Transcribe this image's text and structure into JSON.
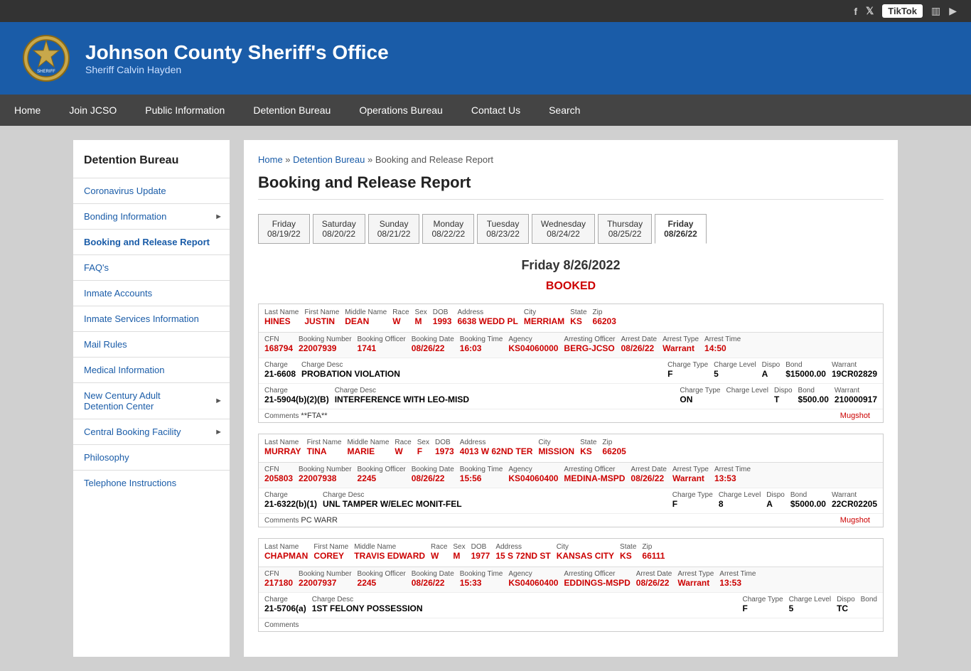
{
  "topBar": {
    "socialLinks": [
      {
        "label": "Facebook",
        "icon": "f",
        "symbol": "f"
      },
      {
        "label": "Twitter",
        "icon": "t",
        "symbol": "𝕏"
      },
      {
        "label": "TikTok",
        "icon": "tiktok",
        "symbol": "TikTok"
      },
      {
        "label": "Instagram",
        "icon": "camera",
        "symbol": "📷"
      },
      {
        "label": "YouTube",
        "icon": "play",
        "symbol": "▶"
      }
    ]
  },
  "header": {
    "title": "Johnson County Sheriff's Office",
    "subtitle": "Sheriff Calvin Hayden"
  },
  "nav": {
    "items": [
      {
        "label": "Home",
        "href": "#"
      },
      {
        "label": "Join JCSO",
        "href": "#"
      },
      {
        "label": "Public Information",
        "href": "#"
      },
      {
        "label": "Detention Bureau",
        "href": "#"
      },
      {
        "label": "Operations Bureau",
        "href": "#"
      },
      {
        "label": "Contact Us",
        "href": "#"
      },
      {
        "label": "Search",
        "href": "#"
      }
    ]
  },
  "sidebar": {
    "title": "Detention Bureau",
    "items": [
      {
        "label": "Coronavirus Update",
        "hasArrow": false
      },
      {
        "label": "Bonding Information",
        "hasArrow": true
      },
      {
        "label": "Booking and Release Report",
        "hasArrow": false,
        "active": true
      },
      {
        "label": "FAQ's",
        "hasArrow": false
      },
      {
        "label": "Inmate Accounts",
        "hasArrow": false
      },
      {
        "label": "Inmate Services Information",
        "hasArrow": false
      },
      {
        "label": "Mail Rules",
        "hasArrow": false
      },
      {
        "label": "Medical Information",
        "hasArrow": false
      },
      {
        "label": "New Century Adult Detention Center",
        "hasArrow": true
      },
      {
        "label": "Central Booking Facility",
        "hasArrow": true
      },
      {
        "label": "Philosophy",
        "hasArrow": false
      },
      {
        "label": "Telephone Instructions",
        "hasArrow": false
      }
    ]
  },
  "breadcrumb": {
    "links": [
      "Home",
      "Detention Bureau"
    ],
    "current": "Booking and Release Report"
  },
  "pageTitle": "Booking and Release Report",
  "dateTabs": [
    {
      "day": "Friday",
      "date": "08/19/22"
    },
    {
      "day": "Saturday",
      "date": "08/20/22"
    },
    {
      "day": "Sunday",
      "date": "08/21/22"
    },
    {
      "day": "Monday",
      "date": "08/22/22"
    },
    {
      "day": "Tuesday",
      "date": "08/23/22"
    },
    {
      "day": "Wednesday",
      "date": "08/24/22"
    },
    {
      "day": "Thursday",
      "date": "08/25/22"
    },
    {
      "day": "Friday",
      "date": "08/26/22",
      "active": true
    }
  ],
  "reportDate": "Friday 8/26/2022",
  "bookedLabel": "BOOKED",
  "inmates": [
    {
      "lastName": "HINES",
      "firstName": "JUSTIN",
      "middleName": "DEAN",
      "race": "W",
      "sex": "M",
      "dob": "1993",
      "address": "6638 WEDD PL",
      "city": "MERRIAM",
      "state": "KS",
      "zip": "66203",
      "cfn": "168794",
      "bookingNumber": "22007939",
      "bookingOfficer": "1741",
      "bookingDate": "08/26/22",
      "bookingTime": "16:03",
      "agency": "KS04060000",
      "arrestingOfficer": "BERG-JCSO",
      "arrestDate": "08/26/22",
      "arrestType": "Warrant",
      "arrestTime": "14:50",
      "charges": [
        {
          "charge": "21-6608",
          "chargeDesc": "PROBATION VIOLATION",
          "chargeType": "F",
          "chargeLevel": "5",
          "dispo": "A",
          "bond": "$15000.00",
          "warrant": "19CR02829"
        },
        {
          "charge": "21-5904(b)(2)(B)",
          "chargeDesc": "INTERFERENCE WITH LEO-MISD",
          "chargeType": "ON",
          "chargeLevel": "",
          "dispo": "T",
          "bond": "$500.00",
          "warrant": "210000917"
        }
      ],
      "comments": "**FTA**",
      "mugshot": "Mugshot"
    },
    {
      "lastName": "MURRAY",
      "firstName": "TINA",
      "middleName": "MARIE",
      "race": "W",
      "sex": "F",
      "dob": "1973",
      "address": "4013 W 62ND TER",
      "city": "MISSION",
      "state": "KS",
      "zip": "66205",
      "cfn": "205803",
      "bookingNumber": "22007938",
      "bookingOfficer": "2245",
      "bookingDate": "08/26/22",
      "bookingTime": "15:56",
      "agency": "KS04060400",
      "arrestingOfficer": "MEDINA-MSPD",
      "arrestDate": "08/26/22",
      "arrestType": "Warrant",
      "arrestTime": "13:53",
      "charges": [
        {
          "charge": "21-6322(b)(1)",
          "chargeDesc": "UNL TAMPER W/ELEC MONIT-FEL",
          "chargeType": "F",
          "chargeLevel": "8",
          "dispo": "A",
          "bond": "$5000.00",
          "warrant": "22CR02205"
        }
      ],
      "comments": "PC WARR",
      "mugshot": "Mugshot"
    },
    {
      "lastName": "CHAPMAN",
      "firstName": "COREY",
      "middleName": "TRAVIS EDWARD",
      "race": "W",
      "sex": "M",
      "dob": "1977",
      "address": "15 S 72ND ST",
      "city": "KANSAS CITY",
      "state": "KS",
      "zip": "66111",
      "cfn": "217180",
      "bookingNumber": "22007937",
      "bookingOfficer": "2245",
      "bookingDate": "08/26/22",
      "bookingTime": "15:33",
      "agency": "KS04060400",
      "arrestingOfficer": "EDDINGS-MSPD",
      "arrestDate": "08/26/22",
      "arrestType": "Warrant",
      "arrestTime": "13:53",
      "charges": [
        {
          "charge": "21-5706(a)",
          "chargeDesc": "1ST FELONY POSSESSION",
          "chargeType": "F",
          "chargeLevel": "5",
          "dispo": "TC",
          "bond": "",
          "warrant": ""
        }
      ],
      "comments": "",
      "mugshot": ""
    }
  ],
  "fieldLabels": {
    "lastName": "Last Name",
    "firstName": "First Name",
    "middleName": "Middle Name",
    "race": "Race",
    "sex": "Sex",
    "dob": "DOB",
    "address": "Address",
    "city": "City",
    "state": "State",
    "zip": "Zip",
    "cfn": "CFN",
    "bookingNumber": "Booking Number",
    "bookingOfficer": "Booking Officer",
    "bookingDate": "Booking Date",
    "bookingTime": "Booking Time",
    "agency": "Agency",
    "arrestingOfficer": "Arresting Officer",
    "arrestDate": "Arrest Date",
    "arrestType": "Arrest Type",
    "arrestTime": "Arrest Time",
    "charge": "Charge",
    "chargeDesc": "Charge Desc",
    "chargeType": "Charge Type",
    "chargeLevel": "Charge Level",
    "dispo": "Dispo",
    "bond": "Bond",
    "warrant": "Warrant",
    "comments": "Comments"
  }
}
